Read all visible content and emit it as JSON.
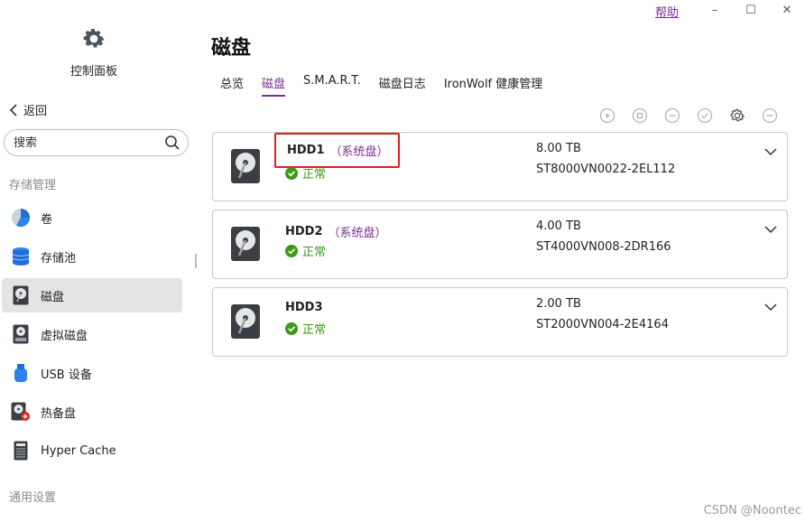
{
  "window": {
    "help_label": "帮助",
    "minimize": "–",
    "maximize": "☐",
    "close": "✕"
  },
  "app": {
    "title": "控制面板",
    "icon": "gear-icon"
  },
  "sidebar": {
    "back_label": "返回",
    "search_placeholder": "搜索",
    "group_storage": "存储管理",
    "group_general": "通用设置",
    "items": [
      {
        "label": "卷",
        "icon": "volume-pie-icon"
      },
      {
        "label": "存储池",
        "icon": "storage-pool-icon"
      },
      {
        "label": "磁盘",
        "icon": "hdd-icon",
        "active": true
      },
      {
        "label": "虚拟磁盘",
        "icon": "virtual-disk-icon"
      },
      {
        "label": "USB 设备",
        "icon": "usb-icon"
      },
      {
        "label": "热备盘",
        "icon": "hot-spare-icon"
      },
      {
        "label": "Hyper Cache",
        "icon": "hyper-cache-icon"
      }
    ]
  },
  "main": {
    "title": "磁盘",
    "tabs": [
      {
        "label": "总览"
      },
      {
        "label": "磁盘",
        "active": true
      },
      {
        "label": "S.M.A.R.T."
      },
      {
        "label": "磁盘日志"
      },
      {
        "label": "IronWolf 健康管理"
      }
    ],
    "toolbar_icons": [
      "play-icon",
      "stop-icon",
      "minus-circle-icon",
      "check-circle-icon",
      "gear-icon",
      "more-icon"
    ],
    "disks": [
      {
        "name": "HDD1",
        "tag": "（系统盘）",
        "status": "正常",
        "size": "8.00 TB",
        "model": "ST8000VN0022-2EL112",
        "highlighted": true
      },
      {
        "name": "HDD2",
        "tag": "（系统盘）",
        "status": "正常",
        "size": "4.00 TB",
        "model": "ST4000VN008-2DR166"
      },
      {
        "name": "HDD3",
        "tag": "",
        "status": "正常",
        "size": "2.00 TB",
        "model": "ST2000VN004-2E4164"
      }
    ]
  },
  "watermark": "CSDN @Noontec",
  "colors": {
    "accent": "#7b2d91",
    "status_ok": "#3c9a16",
    "highlight_border": "#e02020"
  }
}
